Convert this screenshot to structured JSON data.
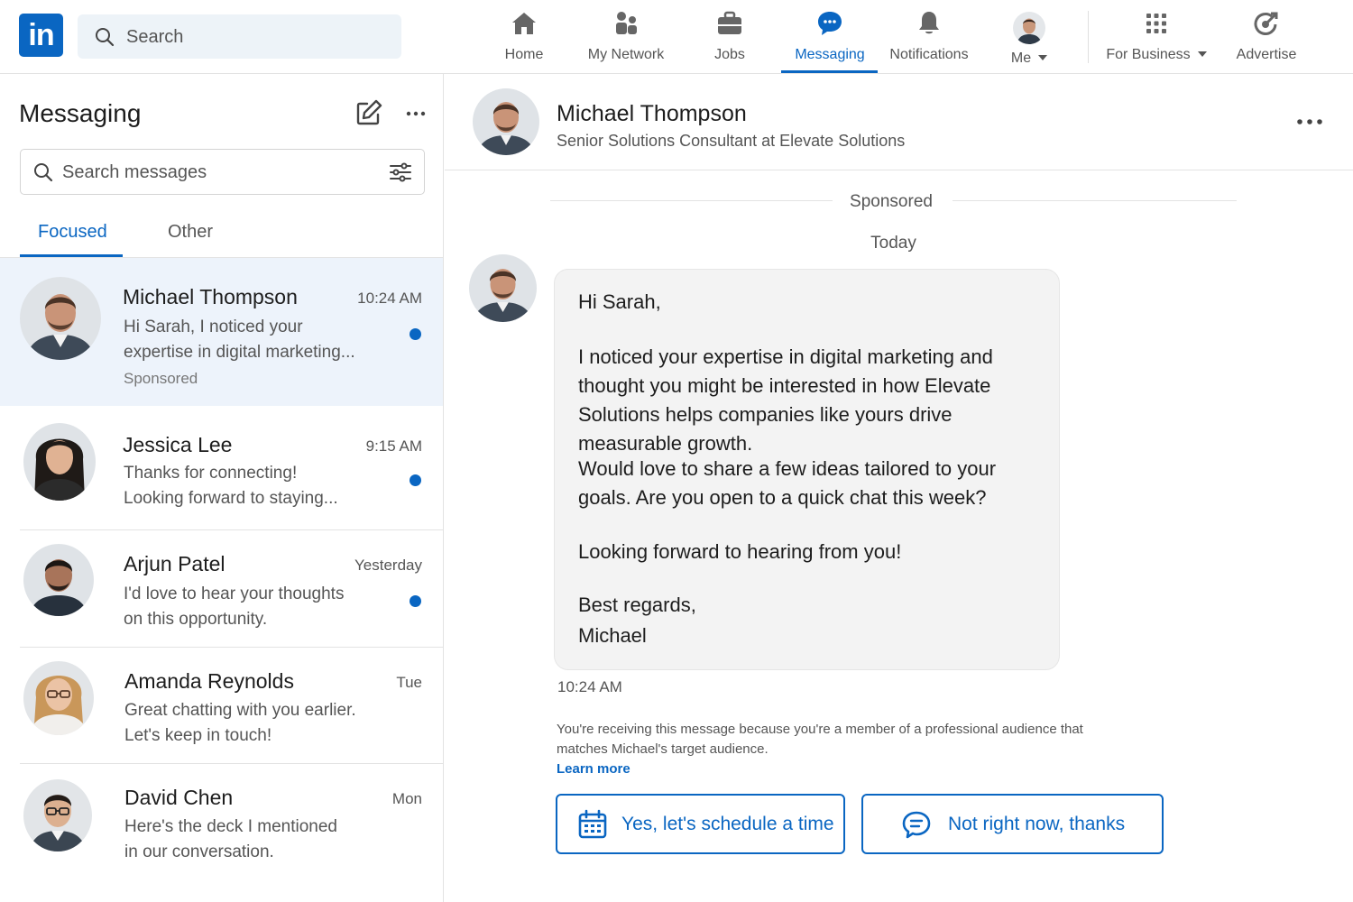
{
  "nav": {
    "logo": "in",
    "search_placeholder": "Search",
    "items": [
      {
        "label": "Home",
        "icon": "home-icon"
      },
      {
        "label": "My Network",
        "icon": "network-icon"
      },
      {
        "label": "Jobs",
        "icon": "briefcase-icon"
      },
      {
        "label": "Messaging",
        "icon": "messaging-icon",
        "active": true
      },
      {
        "label": "Notifications",
        "icon": "bell-icon"
      },
      {
        "label": "Me",
        "icon": "avatar"
      },
      {
        "label": "For Business",
        "icon": "grid-icon"
      },
      {
        "label": "Advertise",
        "icon": "advertise-icon"
      }
    ],
    "accent_color": "#0a66c2"
  },
  "left_panel": {
    "title": "Messaging",
    "search_placeholder": "Search messages",
    "tabs": [
      {
        "label": "Focused",
        "active": true
      },
      {
        "label": "Other",
        "active": false
      }
    ],
    "conversations": [
      {
        "name": "Michael Thompson",
        "time": "10:24 AM",
        "preview": "Hi Sarah, I noticed your expertise in digital marketing...",
        "sponsored": "Sponsored",
        "unread": true,
        "selected": true
      },
      {
        "name": "Jessica Lee",
        "time": "9:15 AM",
        "preview": "Thanks for connecting! Looking forward to staying...",
        "unread": true
      },
      {
        "name": "Arjun Patel",
        "time": "Yesterday",
        "preview": "I'd love to hear your thoughts on this opportunity.",
        "unread": true
      },
      {
        "name": "Amanda Reynolds",
        "time": "Tue",
        "preview": "Great chatting with you earlier. Let's keep in touch!",
        "unread": false
      },
      {
        "name": "David Chen",
        "time": "Mon",
        "preview": "Here's the deck I mentioned in our conversation.",
        "unread": false
      }
    ]
  },
  "thread": {
    "name": "Michael Thompson",
    "headline": "Senior Solutions Consultant at Elevate Solutions",
    "sponsored_label": "Sponsored",
    "date_label": "Today",
    "message": {
      "greeting": "Hi Sarah,",
      "para1": "I noticed your expertise in digital marketing and thought you might be interested in how Elevate Solutions helps companies like yours drive measurable growth.",
      "para2": "Would love to share a few ideas tailored to your goals. Are you open to a quick chat this week?",
      "para3": "Looking forward to hearing from you!",
      "signoff": "Best regards,",
      "signature": "Michael",
      "time": "10:24 AM"
    },
    "disclaimer": "You're receiving this message because you're a member of a professional audience that matches Michael's target audience.",
    "learn_more": "Learn more",
    "actions": [
      {
        "label": "Yes, let's schedule a time",
        "icon": "calendar-icon"
      },
      {
        "label": "Not right now, thanks",
        "icon": "chat-bubble-icon"
      }
    ]
  }
}
